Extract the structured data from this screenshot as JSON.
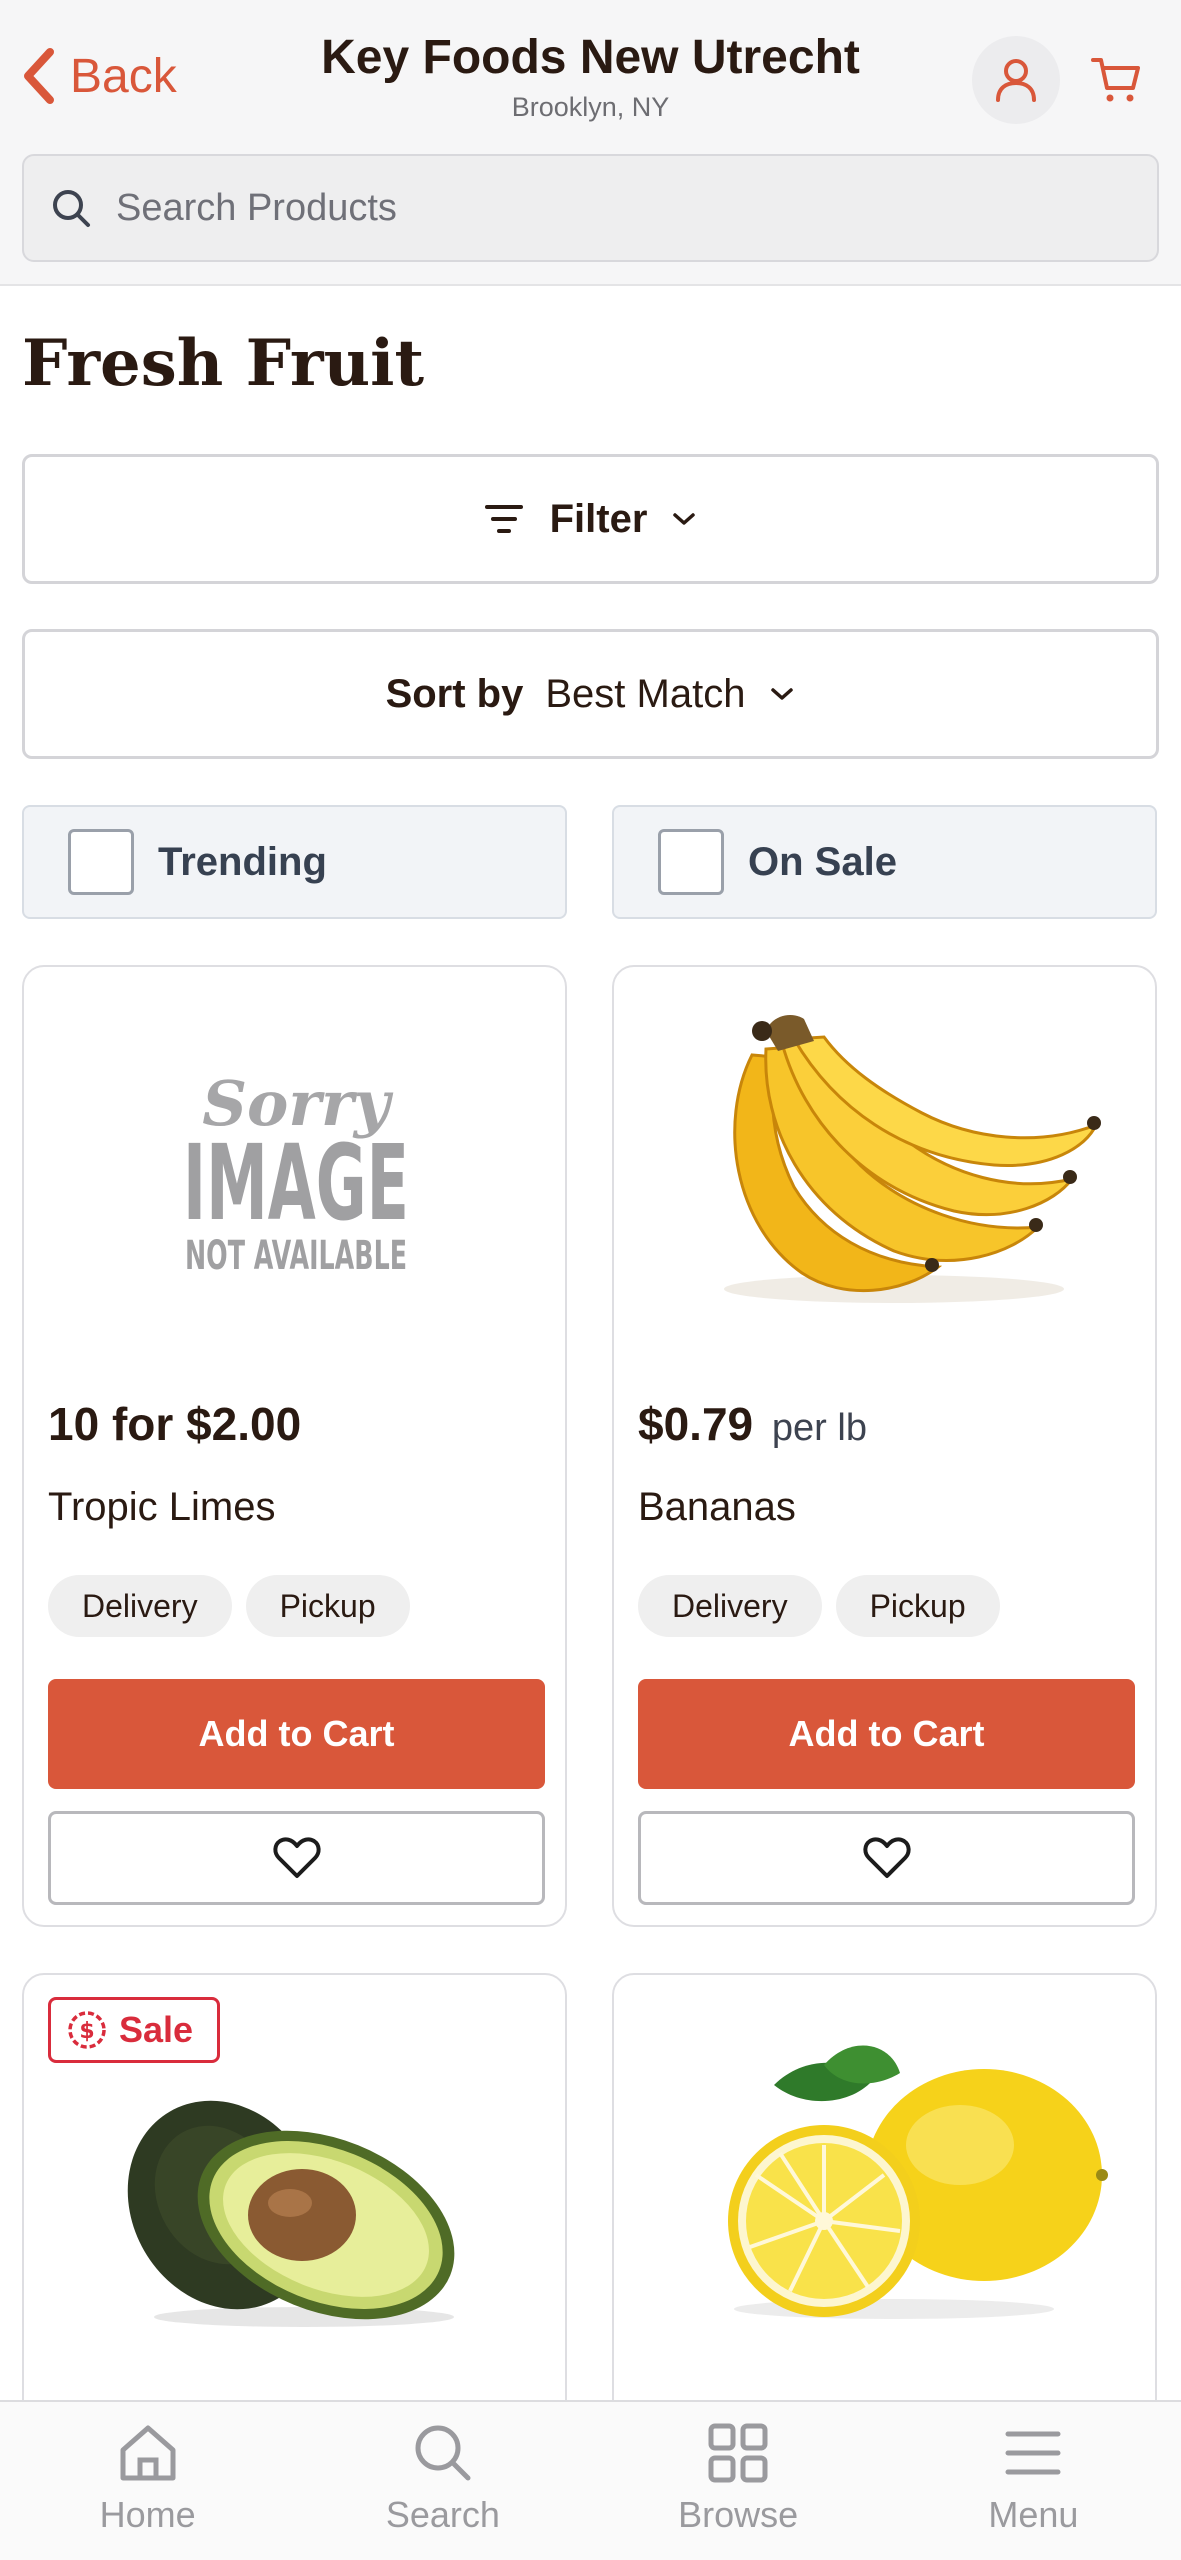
{
  "header": {
    "back_label": "Back",
    "store_name": "Key Foods New Utrecht",
    "store_location": "Brooklyn, NY",
    "account_icon": "person-icon",
    "cart_icon": "cart-icon"
  },
  "search": {
    "placeholder": "Search Products",
    "value": ""
  },
  "page": {
    "title": "Fresh Fruit"
  },
  "filter": {
    "label": "Filter"
  },
  "sort": {
    "label": "Sort by",
    "value": "Best Match"
  },
  "toggles": [
    {
      "label": "Trending",
      "checked": false
    },
    {
      "label": "On Sale",
      "checked": false
    }
  ],
  "products": [
    {
      "name": "Tropic Limes",
      "price": "10 for $2.00",
      "price_unit": "",
      "image_text": {
        "sorry": "Sorry",
        "image": "IMAGE",
        "na": "NOT AVAILABLE"
      },
      "tags": [
        "Delivery",
        "Pickup"
      ],
      "add_label": "Add to Cart"
    },
    {
      "name": "Bananas",
      "price": "$0.79",
      "price_unit": "per lb",
      "tags": [
        "Delivery",
        "Pickup"
      ],
      "add_label": "Add to Cart"
    },
    {
      "badge": "Sale"
    },
    {}
  ],
  "bottom_nav": [
    {
      "label": "Home",
      "icon": "home-icon"
    },
    {
      "label": "Search",
      "icon": "search-icon"
    },
    {
      "label": "Browse",
      "icon": "grid-icon"
    },
    {
      "label": "Menu",
      "icon": "menu-icon"
    }
  ],
  "colors": {
    "accent": "#d9573a",
    "sale": "#d92c3c",
    "text": "#2a1a12",
    "nav_inactive": "#9a9a9e"
  }
}
